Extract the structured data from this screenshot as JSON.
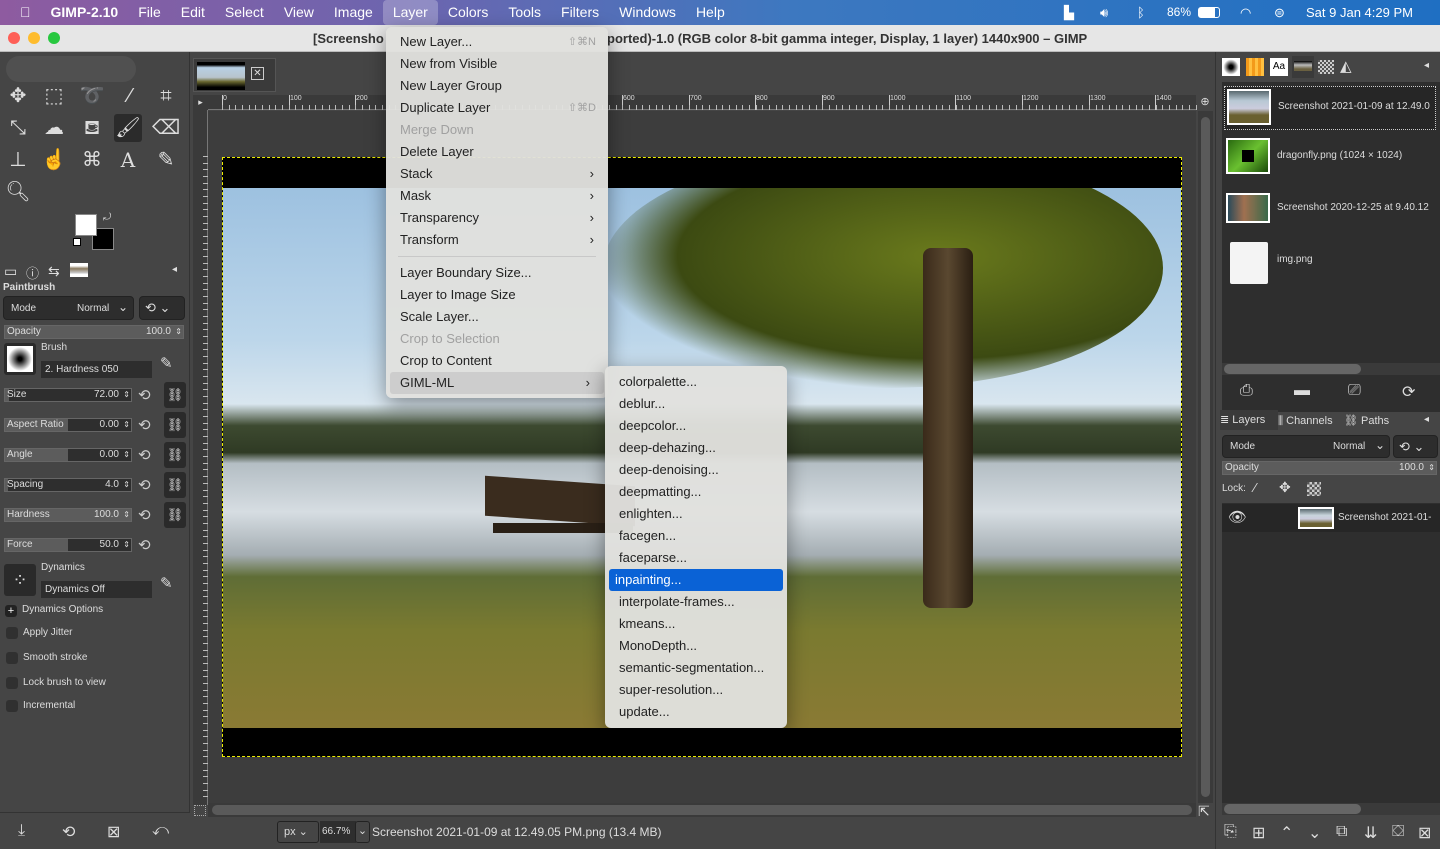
{
  "menubar": {
    "app": "GIMP-2.10",
    "items": [
      "File",
      "Edit",
      "Select",
      "View",
      "Image",
      "Layer",
      "Colors",
      "Tools",
      "Filters",
      "Windows",
      "Help"
    ],
    "active": "Layer",
    "tray": {
      "battery": "86%",
      "datetime": "Sat 9 Jan  4:29 PM"
    }
  },
  "window": {
    "title": "[Screenshot 2021-01-09 at 12.49.05 PM] (imported)-1.0 (RGB color 8-bit gamma integer, Display, 1 layer) 1440x900 – GIMP",
    "title_left": "[Screensho",
    "title_right": "ported)-1.0 (RGB color 8-bit gamma integer, Display, 1 layer) 1440x900 – GIMP"
  },
  "tool_options": {
    "title": "Paintbrush",
    "mode_label": "Mode",
    "mode_value": "Normal",
    "opacity": {
      "label": "Opacity",
      "value": "100.0"
    },
    "brush_label": "Brush",
    "brush_name": "2. Hardness 050",
    "sliders": [
      {
        "label": "Size",
        "value": "72.00",
        "fill": 0.03
      },
      {
        "label": "Aspect Ratio",
        "value": "0.00",
        "fill": 0.5
      },
      {
        "label": "Angle",
        "value": "0.00",
        "fill": 0.5
      },
      {
        "label": "Spacing",
        "value": "4.0",
        "fill": 0.02
      },
      {
        "label": "Hardness",
        "value": "100.0",
        "fill": 1.0
      },
      {
        "label": "Force",
        "value": "50.0",
        "fill": 0.5
      }
    ],
    "dynamics_label": "Dynamics",
    "dynamics_value": "Dynamics Off",
    "dynamics_options": "Dynamics Options",
    "checkboxes": [
      "Apply Jitter",
      "Smooth stroke",
      "Lock brush to view",
      "Incremental"
    ]
  },
  "ruler": {
    "h_labels": [
      "0",
      "100",
      "200",
      "600",
      "700",
      "800",
      "900",
      "1000",
      "1100",
      "1200",
      "1300",
      "1400"
    ]
  },
  "layer_menu": {
    "items": [
      {
        "label": "New Layer...",
        "shortcut": "⇧⌘N"
      },
      {
        "label": "New from Visible"
      },
      {
        "label": "New Layer Group"
      },
      {
        "label": "Duplicate Layer",
        "shortcut": "⇧⌘D"
      },
      {
        "label": "Merge Down",
        "disabled": true
      },
      {
        "label": "Delete Layer"
      },
      {
        "label": "Stack",
        "submenu": true
      },
      {
        "label": "Mask",
        "submenu": true
      },
      {
        "label": "Transparency",
        "submenu": true
      },
      {
        "label": "Transform",
        "submenu": true
      },
      {
        "sep": true
      },
      {
        "label": "Layer Boundary Size..."
      },
      {
        "label": "Layer to Image Size"
      },
      {
        "label": "Scale Layer..."
      },
      {
        "label": "Crop to Selection",
        "disabled": true
      },
      {
        "label": "Crop to Content"
      },
      {
        "label": "GIML-ML",
        "submenu": true,
        "highlight": true
      }
    ]
  },
  "gimlml_menu": {
    "items": [
      "colorpalette...",
      "deblur...",
      "deepcolor...",
      "deep-dehazing...",
      "deep-denoising...",
      "deepmatting...",
      "enlighten...",
      "facegen...",
      "faceparse...",
      "inpainting...",
      "interpolate-frames...",
      "kmeans...",
      "MonoDepth...",
      "semantic-segmentation...",
      "super-resolution...",
      "update..."
    ],
    "selected": "inpainting..."
  },
  "images_panel": {
    "items": [
      "Screenshot 2021-01-09 at 12.49.0",
      "dragonfly.png (1024 × 1024)",
      "Screenshot 2020-12-25 at 9.40.12",
      "img.png"
    ]
  },
  "layers_panel": {
    "tabs": [
      "Layers",
      "Channels",
      "Paths"
    ],
    "mode_label": "Mode",
    "mode_value": "Normal",
    "opacity_label": "Opacity",
    "opacity_value": "100.0",
    "lock_label": "Lock:",
    "layer_name": "Screenshot 2021-01-"
  },
  "status": {
    "unit": "px",
    "zoom": "66.7%",
    "file": "Screenshot 2021-01-09 at 12.49.05 PM.png (13.4 MB)"
  },
  "colors": {
    "accent": "#0a62d6"
  }
}
